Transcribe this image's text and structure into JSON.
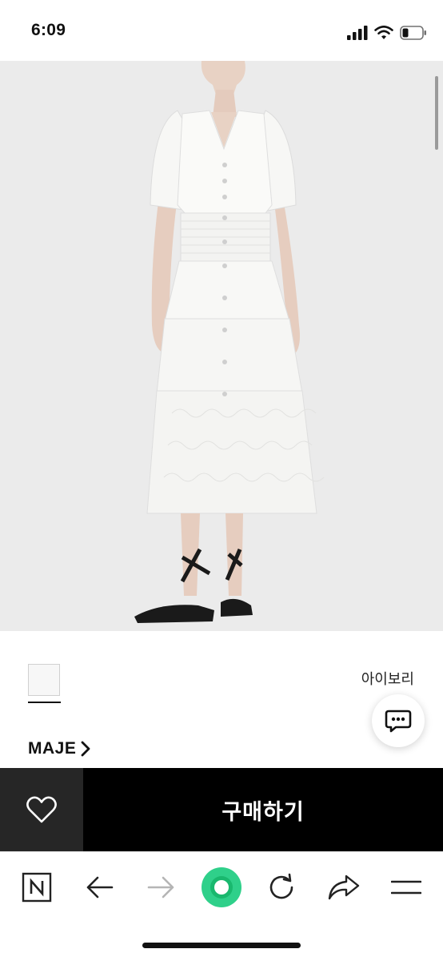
{
  "status_bar": {
    "time": "6:09"
  },
  "product": {
    "color_option": "아이보리",
    "brand": "MAJE"
  },
  "purchase": {
    "buy_label": "구매하기"
  },
  "colors": {
    "accent_green": "#2fd08a",
    "buy_bg": "#000000",
    "wishlist_bg": "#262626"
  },
  "icons": {
    "toolbar": [
      "naver-n-icon",
      "back-arrow-icon",
      "forward-arrow-icon",
      "green-home-icon",
      "refresh-icon",
      "share-icon",
      "menu-icon"
    ]
  }
}
